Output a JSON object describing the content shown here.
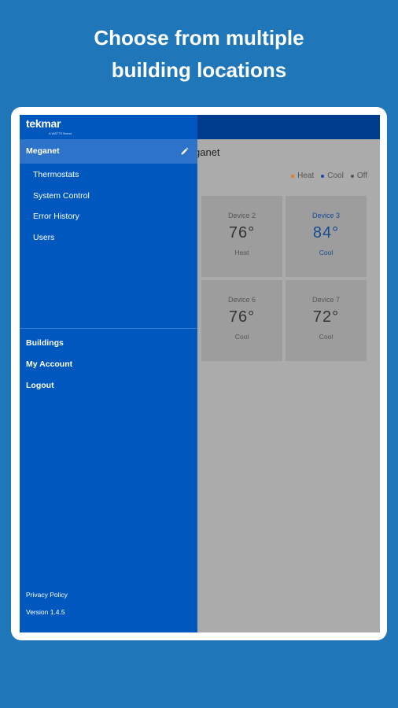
{
  "headline": {
    "line1": "Choose from multiple",
    "line2": "building locations"
  },
  "colors": {
    "background": "#1f77ba",
    "drawer": "#0058bf",
    "topbar": "#003d8f",
    "heat": "#e07a1e",
    "cool": "#164a92",
    "off": "#555555"
  },
  "brand": {
    "logo": "tekmar",
    "tagline": "A WATTS Brand"
  },
  "drawer": {
    "site": "Meganet",
    "nav": [
      "Thermostats",
      "System Control",
      "Error History",
      "Users"
    ],
    "bottom": [
      "Buildings",
      "My Account",
      "Logout"
    ],
    "privacy": "Privacy Policy",
    "version": "Version 1.4.5"
  },
  "background_view": {
    "title_fragment": "ganet",
    "legend": [
      "Heat",
      "Cool",
      "Off"
    ],
    "devices": [
      {
        "name": "Device 2",
        "temp": "76°",
        "mode": "Heat"
      },
      {
        "name": "Device 3",
        "temp": "84°",
        "mode": "Cool"
      },
      {
        "name": "Device 6",
        "temp": "76°",
        "mode": "Cool"
      },
      {
        "name": "Device 7",
        "temp": "72°",
        "mode": "Cool"
      }
    ]
  }
}
